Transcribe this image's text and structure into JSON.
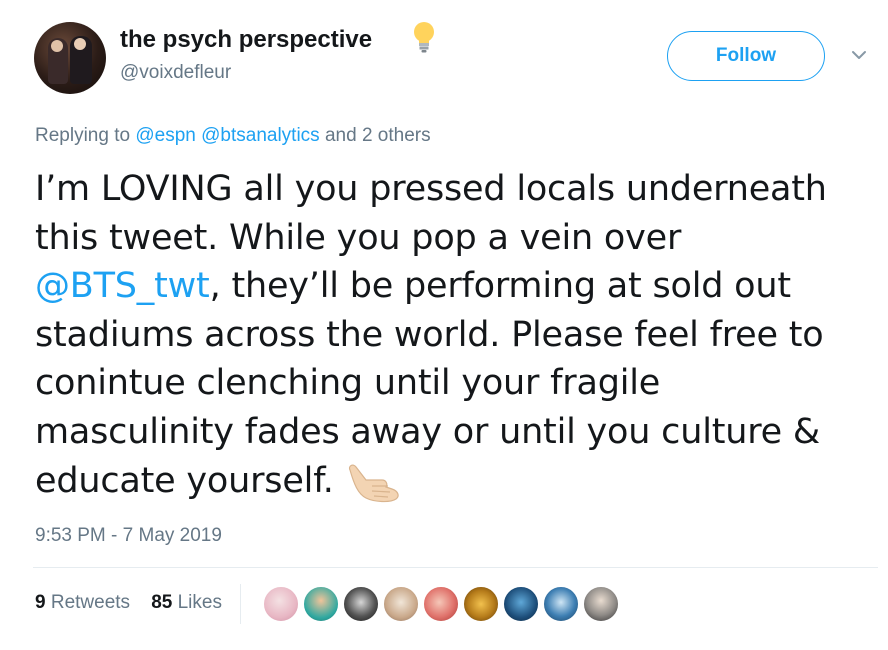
{
  "author": {
    "display_name": "the psych perspective",
    "handle": "@voixdefleur",
    "avatar_icon": "profile-photo",
    "badge_icon": "lightbulb-emoji"
  },
  "follow_button": {
    "label": "Follow"
  },
  "menu_icon": "chevron-down-icon",
  "reply_context": {
    "prefix": "Replying to",
    "mention1": "@espn",
    "mention2": "@btsanalytics",
    "suffix": "and 2 others"
  },
  "tweet": {
    "line1": "I’m LOVING all you pressed locals underneath",
    "line2": "this tweet. While you pop a vein over",
    "line3_mention": "@BTS_twt",
    "line3_rest": ", they’ll be performing at sold out",
    "line4": "stadiums across the world. Please feel free to",
    "line5": "conintue clenching until your fragile",
    "line6": "masculinity fades away or until you culture &",
    "line7": "educate yourself.",
    "emoji_icon": "call-me-hand-emoji"
  },
  "timestamp": "9:53 PM - 7 May 2019",
  "stats": {
    "retweets_count": "9",
    "retweets_label": "Retweets",
    "likes_count": "85",
    "likes_label": "Likes"
  },
  "colors": {
    "accent": "#1da1f2",
    "secondary_text": "#657786",
    "primary_text": "#14171a"
  }
}
